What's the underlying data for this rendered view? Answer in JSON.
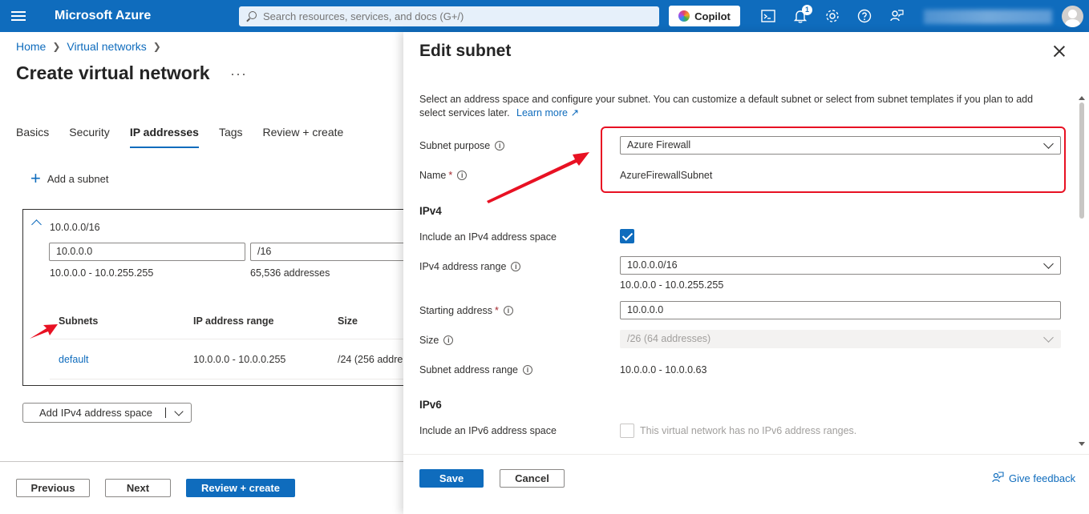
{
  "topbar": {
    "brand": "Microsoft Azure",
    "search_placeholder": "Search resources, services, and docs (G+/)",
    "copilot_label": "Copilot",
    "notification_count": "1",
    "icons": [
      "cloud-shell-icon",
      "notifications-icon",
      "settings-icon",
      "help-icon",
      "feedback-icon"
    ],
    "accent": "#0f6cbd"
  },
  "breadcrumb": [
    "Home",
    "Virtual networks"
  ],
  "page": {
    "title": "Create virtual network",
    "more": "···"
  },
  "tabs": [
    {
      "label": "Basics",
      "active": false
    },
    {
      "label": "Security",
      "active": false
    },
    {
      "label": "IP addresses",
      "active": true
    },
    {
      "label": "Tags",
      "active": false
    },
    {
      "label": "Review + create",
      "active": false
    }
  ],
  "address_space": {
    "add_subnet_label": "Add a subnet",
    "title": "10.0.0.0/16",
    "address_value": "10.0.0.0",
    "prefix_value": "/16",
    "range_text": "10.0.0.0 - 10.0.255.255",
    "count_text": "65,536 addresses",
    "columns": [
      "Subnets",
      "IP address range",
      "Size"
    ],
    "rows": [
      {
        "name": "default",
        "range": "10.0.0.0 - 10.0.0.255",
        "size": "/24 (256 addre"
      }
    ],
    "add_ipv4_label": "Add IPv4 address space"
  },
  "footer": {
    "previous": "Previous",
    "next": "Next",
    "review": "Review + create"
  },
  "panel": {
    "title": "Edit subnet",
    "description": "Select an address space and configure your subnet. You can customize a default subnet or select from subnet templates if you plan to add select services later.",
    "learn_more": "Learn more",
    "subnet_purpose_label": "Subnet purpose",
    "subnet_purpose_value": "Azure Firewall",
    "name_label": "Name",
    "name_value": "AzureFirewallSubnet",
    "ipv4_heading": "IPv4",
    "include_ipv4_label": "Include an IPv4 address space",
    "include_ipv4_checked": true,
    "ipv4_range_label": "IPv4 address range",
    "ipv4_range_value": "10.0.0.0/16",
    "ipv4_range_text": "10.0.0.0 - 10.0.255.255",
    "starting_label": "Starting address",
    "starting_value": "10.0.0.0",
    "size_label": "Size",
    "size_value": "/26 (64 addresses)",
    "subnet_range_label": "Subnet address range",
    "subnet_range_value": "10.0.0.0 - 10.0.0.63",
    "ipv6_heading": "IPv6",
    "include_ipv6_label": "Include an IPv6 address space",
    "ipv6_note": "This virtual network has no IPv6 address ranges.",
    "save": "Save",
    "cancel": "Cancel",
    "feedback": "Give feedback",
    "highlight_color": "#e81123"
  }
}
